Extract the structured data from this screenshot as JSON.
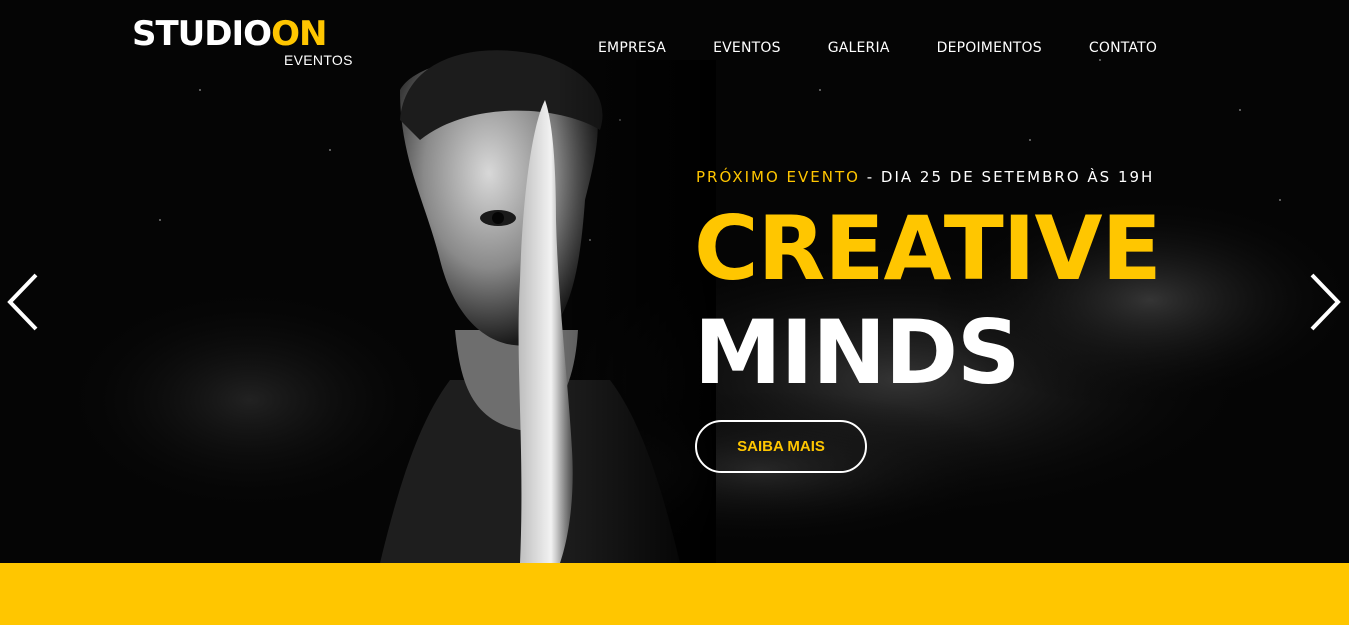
{
  "brand": {
    "logo_part1": "STUDIO",
    "logo_part2": "ON",
    "logo_sub": "EVENTOS",
    "accent_color": "#ffc600"
  },
  "nav": {
    "items": [
      {
        "label": "EMPRESA"
      },
      {
        "label": "EVENTOS"
      },
      {
        "label": "GALERIA"
      },
      {
        "label": "DEPOIMENTOS"
      },
      {
        "label": "CONTATO"
      }
    ]
  },
  "hero": {
    "event_label": "PRÓXIMO EVENTO",
    "event_separator": " - ",
    "event_date": "DIA 25 DE SETEMBRO ÀS 19H",
    "title_line1": "CREATIVE",
    "title_line2": "MINDS",
    "cta_label": "SAIBA MAIS",
    "prev_icon": "chevron-left-icon",
    "next_icon": "chevron-right-icon"
  }
}
